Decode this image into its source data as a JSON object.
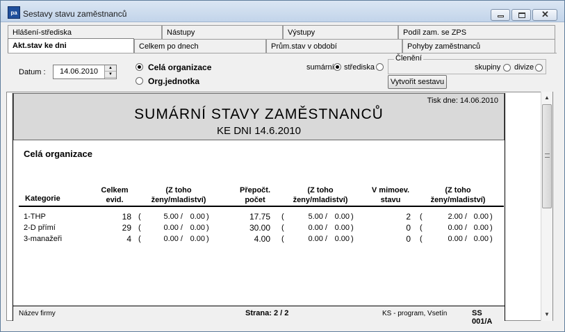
{
  "window": {
    "title": "Sestavy stavu zaměstnanců",
    "icon": "app-icon"
  },
  "tabs_row1": [
    {
      "label": "Hlášení-střediska"
    },
    {
      "label": "Nástupy"
    },
    {
      "label": "Výstupy"
    },
    {
      "label": "Podíl zam. se ZPS"
    }
  ],
  "tabs_row2": [
    {
      "label": "Akt.stav ke dni",
      "active": true
    },
    {
      "label": "Celkem po dnech"
    },
    {
      "label": "Prům.stav v období"
    },
    {
      "label": "Pohyby zaměstnanců"
    }
  ],
  "controls": {
    "datum_label": "Datum :",
    "datum_value": "14.06.2010",
    "scope_options": [
      {
        "label": "Celá organizace",
        "selected": true
      },
      {
        "label": "Org.jednotka",
        "selected": false
      }
    ],
    "sumarni_label": "sumární",
    "strediska_label": "střediska",
    "cleneni_label": "Členění",
    "skupiny_label": "skupiny",
    "divize_label": "divize",
    "create_button": "Vytvořit sestavu"
  },
  "report": {
    "print_date": "Tisk dne: 14.06.2010",
    "title": "SUMÁRNÍ  STAVY  ZAMĚSTNANCŮ",
    "subtitle": "KE DNI 14.6.2010",
    "scope": "Celá organizace",
    "headers": {
      "kategorie": "Kategorie",
      "celkem": "Celkem\nevid.",
      "ztoho1": "(Z toho\nženy/mladiství)",
      "prepoct": "Přepočt.\npočet",
      "ztoho2": "(Z toho\nženy/mladiství)",
      "mimoev": "V mimoev.\nstavu",
      "ztoho3": "(Z toho\nženy/mladiství)"
    },
    "rows": [
      {
        "kategorie": "1-THP",
        "celkem": "18",
        "z1a": "5.00 /",
        "z1b": "0.00",
        "prepoct": "17.75",
        "z2a": "5.00 /",
        "z2b": "0.00",
        "mimoev": "2",
        "z3a": "2.00 /",
        "z3b": "0.00"
      },
      {
        "kategorie": "2-D přímí",
        "celkem": "29",
        "z1a": "0.00 /",
        "z1b": "0.00",
        "prepoct": "30.00",
        "z2a": "0.00 /",
        "z2b": "0.00",
        "mimoev": "0",
        "z3a": "0.00 /",
        "z3b": "0.00"
      },
      {
        "kategorie": "3-manažeři",
        "celkem": "4",
        "z1a": "0.00 /",
        "z1b": "0.00",
        "prepoct": "4.00",
        "z2a": "0.00 /",
        "z2b": "0.00",
        "mimoev": "0",
        "z3a": "0.00 /",
        "z3b": "0.00"
      }
    ],
    "footer": {
      "firm": "Název firmy",
      "page": "Strana: 2 / 2",
      "vendor": "KS - program, Vsetín",
      "code": "SS 001/A"
    }
  }
}
